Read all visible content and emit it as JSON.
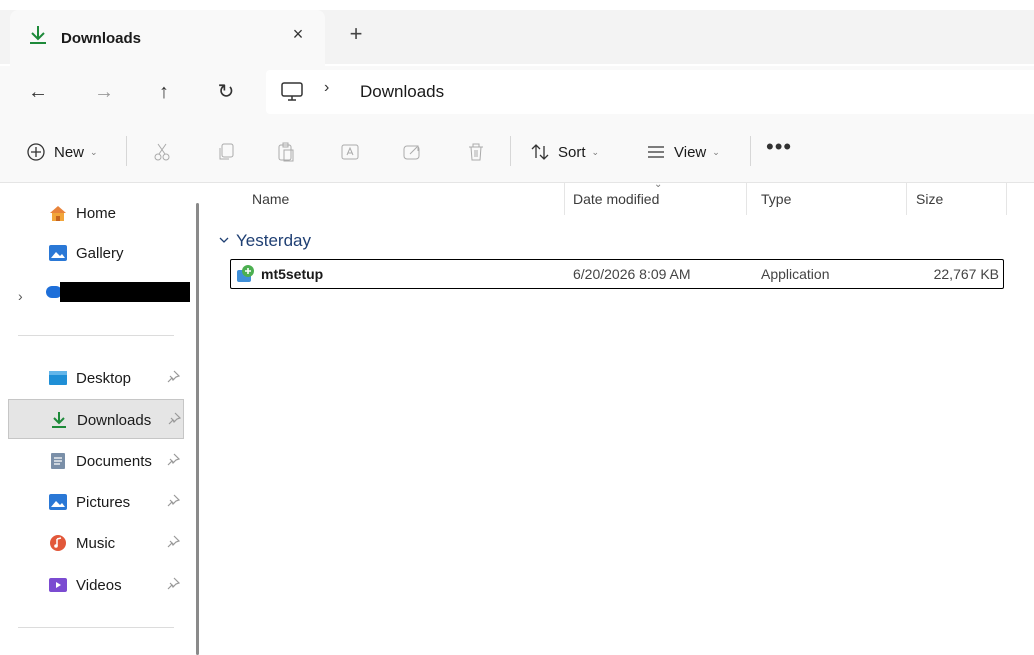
{
  "tab": {
    "title": "Downloads",
    "close_glyph": "×",
    "new_glyph": "+"
  },
  "nav": {
    "back": "←",
    "forward": "→",
    "up": "↑",
    "refresh": "↻"
  },
  "address": {
    "separator": "›",
    "crumb": "Downloads"
  },
  "toolbar": {
    "new_label": "New",
    "sort_label": "Sort",
    "view_label": "View",
    "chevron": "⌄",
    "more": "•••"
  },
  "sidebar": {
    "expand_glyph": "›",
    "items": [
      {
        "label": "Home",
        "icon": "home-icon"
      },
      {
        "label": "Gallery",
        "icon": "gallery-icon"
      },
      {
        "label": "Desktop",
        "icon": "desktop-icon",
        "pinned": true
      },
      {
        "label": "Downloads",
        "icon": "downloads-icon",
        "pinned": true,
        "selected": true
      },
      {
        "label": "Documents",
        "icon": "documents-icon",
        "pinned": true
      },
      {
        "label": "Pictures",
        "icon": "pictures-icon",
        "pinned": true
      },
      {
        "label": "Music",
        "icon": "music-icon",
        "pinned": true
      },
      {
        "label": "Videos",
        "icon": "videos-icon",
        "pinned": true
      }
    ]
  },
  "columns": {
    "name": "Name",
    "date": "Date modified",
    "type": "Type",
    "size": "Size"
  },
  "group": {
    "label": "Yesterday"
  },
  "files": [
    {
      "name": "mt5setup",
      "date": "6/20/2026 8:09 AM",
      "type": "Application",
      "size": "22,767 KB"
    }
  ],
  "colors": {
    "accent": "#1e7c2e",
    "selection": "#e5e5e5",
    "group_text": "#1f3f73"
  }
}
